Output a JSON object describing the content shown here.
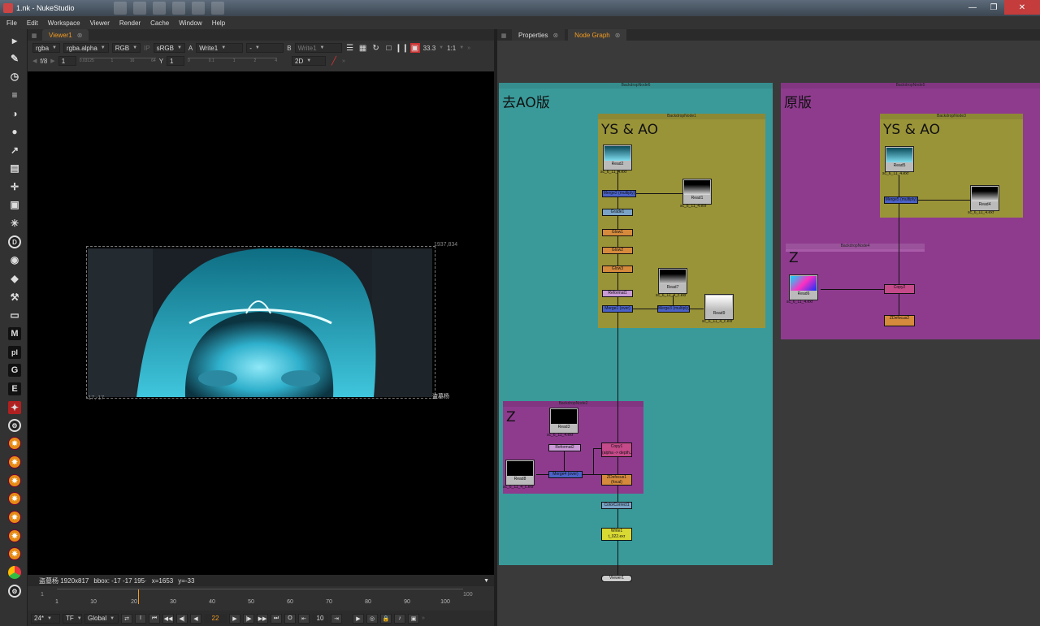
{
  "window": {
    "title": "1.nk - NukeStudio"
  },
  "menu": [
    "File",
    "Edit",
    "Workspace",
    "Viewer",
    "Render",
    "Cache",
    "Window",
    "Help"
  ],
  "toolbar_letters": {
    "m": "M",
    "pl": "pl",
    "g": "G",
    "e": "E"
  },
  "viewer": {
    "tab": "Viewer1",
    "channels": "rgba",
    "alpha": "rgba.alpha",
    "display": "RGB",
    "ip": "IP",
    "colorspace": "sRGB",
    "a_label": "A",
    "a_input": "Write1",
    "dash": "-",
    "b_label": "B",
    "b_input": "Write1",
    "zoom": "33.3",
    "ratio": "1:1",
    "fstop": "f/8",
    "gain": "1",
    "y_label": "Y",
    "gamma": "1",
    "mode": "2D",
    "gain_ticks": [
      "0.03125",
      "1",
      "16",
      "64"
    ],
    "gamma_ticks": [
      "0",
      "0.1",
      "1",
      "2",
      "4"
    ],
    "bbox_tr": "1937,834",
    "bbox_bl": "-17,-17",
    "format_label": "盗墓杨",
    "status": {
      "format": "盗墓杨 1920x817",
      "bbox": "bbox: -17 -17 195·",
      "x": "x=1653",
      "y": "y=-33"
    }
  },
  "timeline": {
    "start": "1",
    "end": "100",
    "ticks": [
      "1",
      "10",
      "20",
      "30",
      "40",
      "50",
      "60",
      "70",
      "80",
      "90",
      "100"
    ],
    "current_frame": "22",
    "fps": "24*",
    "tf": "TF",
    "scope": "Global",
    "step": "10"
  },
  "nodegraph": {
    "tabs": [
      "Properties",
      "Node Graph"
    ],
    "backdrops": {
      "b6": {
        "name": "BackdropNode6",
        "label": "去AO版"
      },
      "b1": {
        "name": "BackdropNode1",
        "label": "YS & AO"
      },
      "b2": {
        "name": "BackdropNode2",
        "label": "Z"
      },
      "b5": {
        "name": "BackdropNode5",
        "label": "原版"
      },
      "b3": {
        "name": "BackdropNode3",
        "label": "YS & AO"
      },
      "b4": {
        "name": "BackdropNode4",
        "label": "Z"
      }
    },
    "nodes": {
      "read2": {
        "name": "Read2",
        "file": "sc_6_11_4.exr"
      },
      "read1": {
        "name": "Read1",
        "file": "sc_6_11_4.exr"
      },
      "read7": {
        "name": "Read7",
        "file": "sc_6_11_4_c.exr"
      },
      "read9": {
        "name": "Read9",
        "file": "sc_6_11_4_c.exr"
      },
      "read3": {
        "name": "Read3",
        "file": "sc_6_11_4.exr"
      },
      "read8": {
        "name": "Read8",
        "file": "sc_6_11_4_c.exr"
      },
      "read5": {
        "name": "Read5",
        "file": "sc_6_11_4.exr"
      },
      "read4": {
        "name": "Read4",
        "file": "sc_6_11_4.exr"
      },
      "read6": {
        "name": "Read6",
        "file": "sc_6_11_4.exr"
      },
      "merge_mult": "Merge2 (multiply)",
      "grade1": "Grade1",
      "glow1": "Glow1",
      "glow2": "Glow2",
      "glow3": "Glow3",
      "reformat1": "Reformat1",
      "merge_over": "Merge1 (over)",
      "merge_mult2": "Merge3 (multiply)",
      "reformat2": "Reformat2",
      "merge_over2": "Merge4 (over)",
      "copy1": "Copy1",
      "copy1_sub": "(alpha -> depth.Z)",
      "zdefocus1": "ZDefocus1",
      "zdefocus1_sub": "(focal)",
      "colorcorrect1": "ColorCorrect1",
      "write1": "Write1",
      "write1_file": "t_022.exr",
      "viewer1": "Viewer1",
      "merge_mult3": "Merge5 (multiply)",
      "copy2": "Copy2",
      "zdefocus2": "ZDefocus2"
    }
  }
}
